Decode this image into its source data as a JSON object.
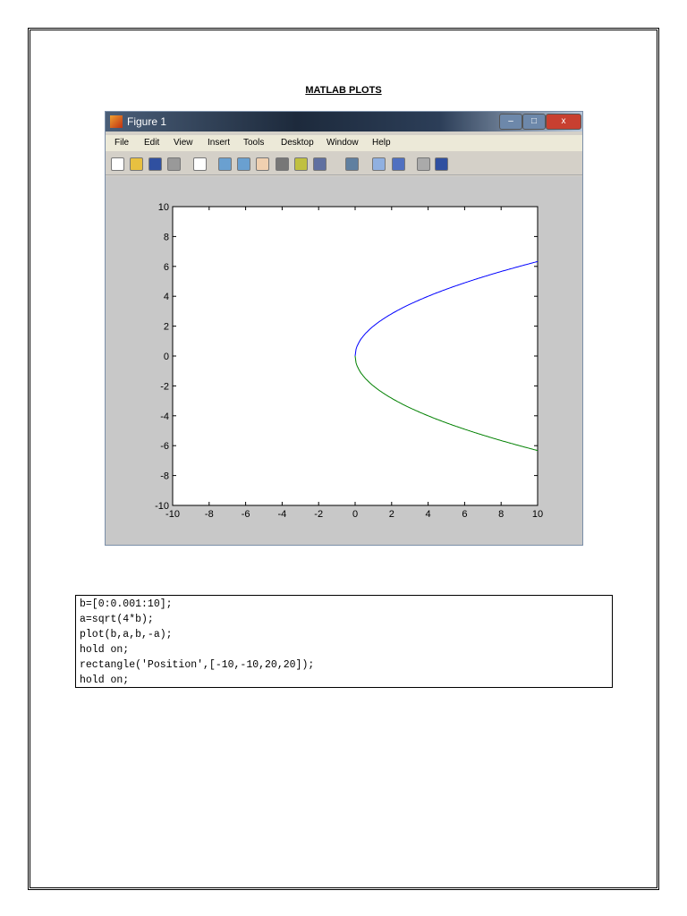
{
  "document": {
    "title": "MATLAB PLOTS"
  },
  "window": {
    "title": "Figure 1",
    "menu": [
      "File",
      "Edit",
      "View",
      "Insert",
      "Tools",
      "Desktop",
      "Window",
      "Help"
    ],
    "toolbar_icons": [
      "new-file-icon",
      "open-folder-icon",
      "save-icon",
      "print-icon",
      "pointer-icon",
      "zoom-in-icon",
      "zoom-out-icon",
      "pan-hand-icon",
      "rotate-3d-icon",
      "data-cursor-icon",
      "brush-icon",
      "link-plot-icon",
      "colorbar-icon",
      "legend-icon",
      "hide-plot-tools-icon",
      "show-plot-tools-icon"
    ]
  },
  "chart_data": {
    "type": "line",
    "title": "",
    "xlabel": "",
    "ylabel": "",
    "xlim": [
      -10,
      10
    ],
    "ylim": [
      -10,
      10
    ],
    "xticks": [
      "-10",
      "-8",
      "-6",
      "-4",
      "-2",
      "0",
      "2",
      "4",
      "6",
      "8",
      "10"
    ],
    "yticks": [
      "-10",
      "-8",
      "-6",
      "-4",
      "-2",
      "0",
      "2",
      "4",
      "6",
      "8",
      "10"
    ],
    "series": [
      {
        "name": "a = sqrt(4*b)",
        "color": "#0000ff",
        "function": "y=2*sqrt(x)",
        "x_range": [
          0,
          10
        ]
      },
      {
        "name": "-a",
        "color": "#008000",
        "function": "y=-2*sqrt(x)",
        "x_range": [
          0,
          10
        ]
      }
    ],
    "rectangle": {
      "position": [
        -10,
        -10,
        20,
        20
      ]
    }
  },
  "code": {
    "lines": [
      "b=[0:0.001:10];",
      "a=sqrt(4*b);",
      "plot(b,a,b,-a);",
      "hold on;",
      "rectangle('Position',[-10,-10,20,20]);",
      "hold on;"
    ]
  }
}
